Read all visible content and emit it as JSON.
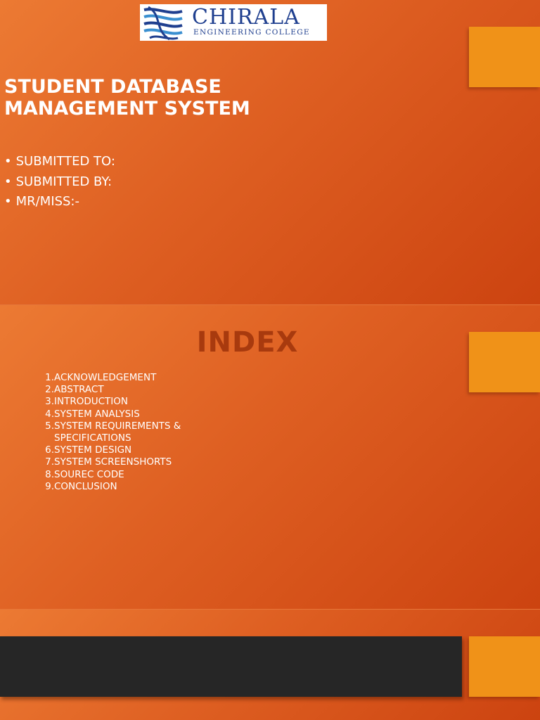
{
  "logo": {
    "name": "CHIRALA",
    "subtitle": "ENGINEERING COLLEGE",
    "brand_color": "#1f3f8f"
  },
  "slide1": {
    "title_lines": [
      "STUDENT DATABASE",
      "MANAGEMENT SYSTEM"
    ],
    "bullets": [
      "SUBMITTED TO:",
      "SUBMITTED BY:",
      "MR/MISS:-"
    ]
  },
  "slide2": {
    "title": "INDEX",
    "items": [
      {
        "num": "1.",
        "text": "ACKNOWLEDGEMENT"
      },
      {
        "num": "2.",
        "text": "ABSTRACT"
      },
      {
        "num": "3.",
        "text": "INTRODUCTION"
      },
      {
        "num": "4.",
        "text": "SYSTEM ANALYSIS"
      },
      {
        "num": "5.",
        "text": "SYSTEM REQUIREMENTS & SPECIFICATIONS"
      },
      {
        "num": "6.",
        "text": "SYSTEM  DESIGN"
      },
      {
        "num": "7.",
        "text": "SYSTEM SCREENSHORTS"
      },
      {
        "num": "8.",
        "text": "SOUREC CODE"
      },
      {
        "num": "9.",
        "text": "CONCLUSION"
      }
    ]
  },
  "colors": {
    "background_start": "#ec7a33",
    "background_end": "#cc4310",
    "accent": "#f09218",
    "index_title": "#a83a0e",
    "dark_bar": "#262626",
    "text": "#ffffff"
  }
}
